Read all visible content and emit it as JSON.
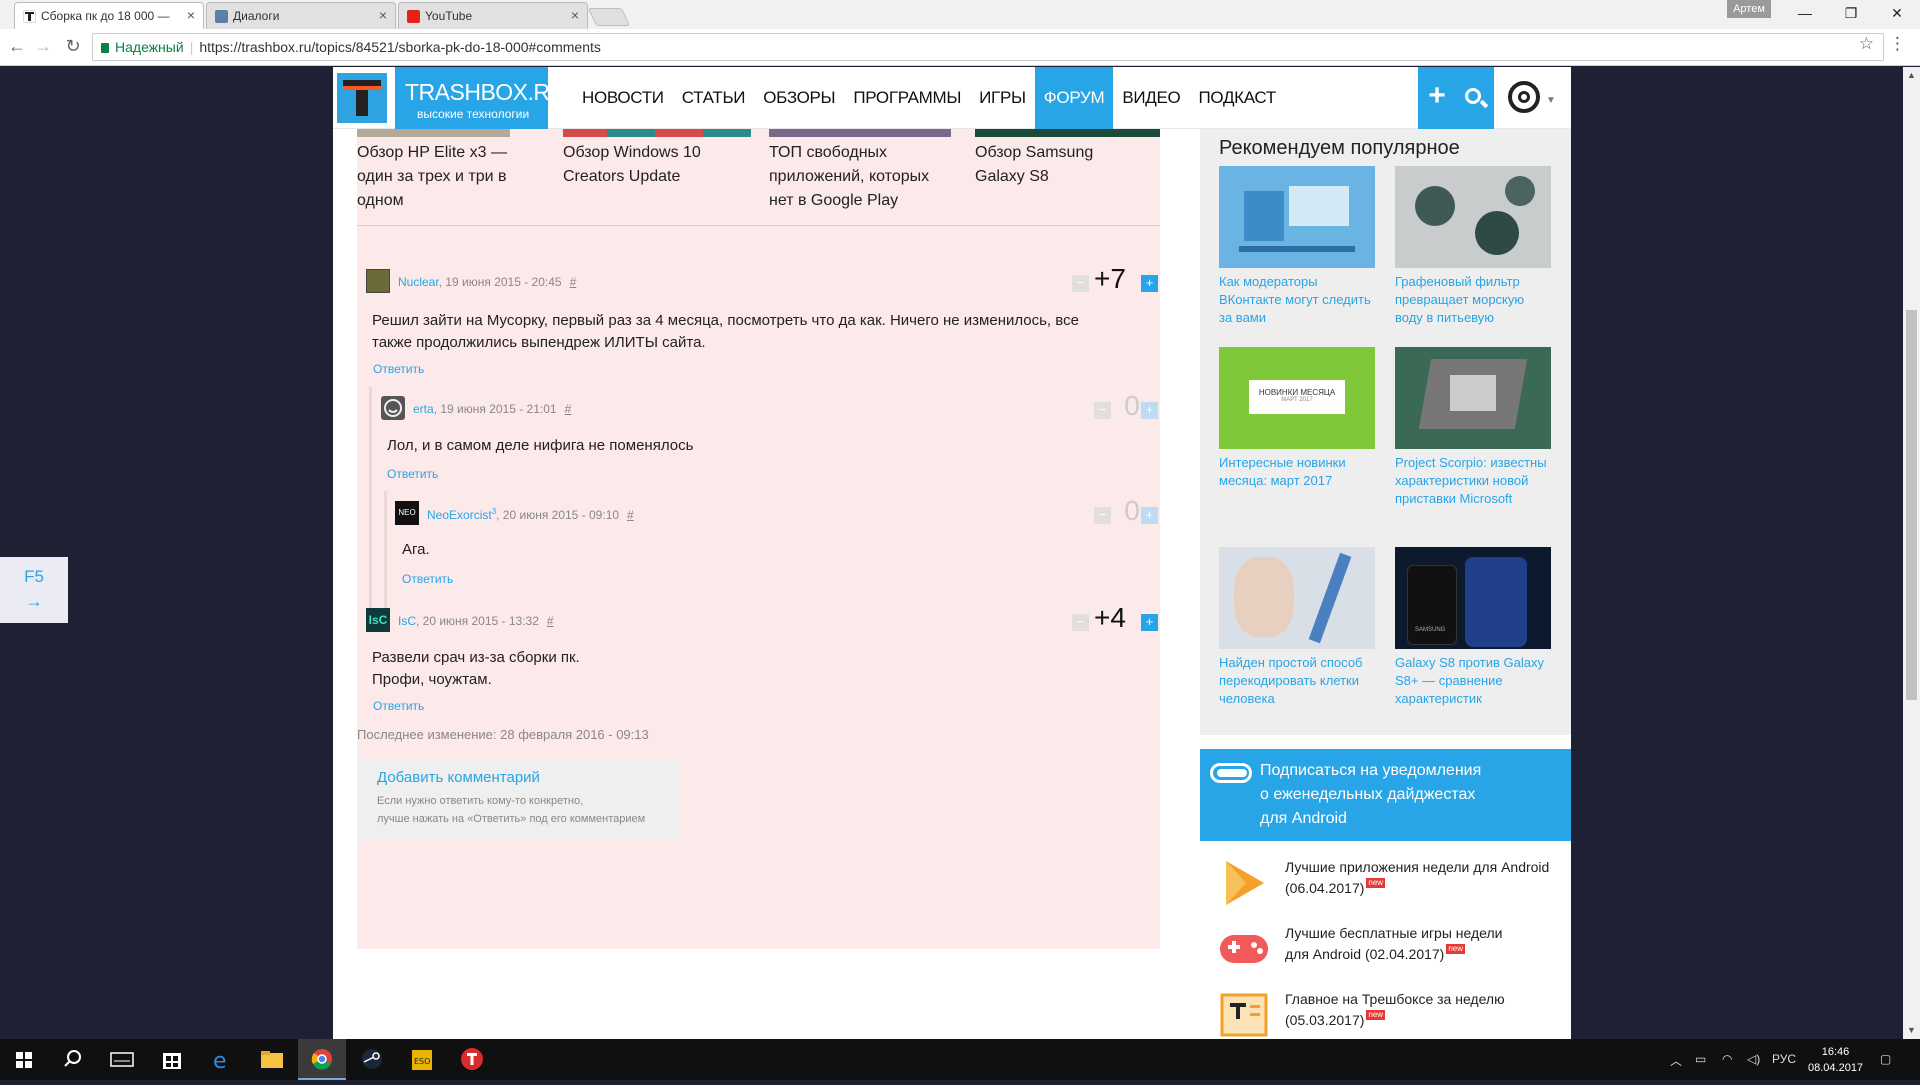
{
  "browser": {
    "tabs": [
      {
        "title": "Сборка пк до 18 000 —",
        "icon": "trashbox-favicon",
        "active": true
      },
      {
        "title": "Диалоги",
        "icon": "vk-favicon",
        "active": false
      },
      {
        "title": "YouTube",
        "icon": "youtube-favicon",
        "active": false
      }
    ],
    "user_badge": "Артем",
    "secure_label": "Надежный",
    "url": "https://trashbox.ru/topics/84521/sborka-pk-do-18-000#comments"
  },
  "site": {
    "brand_name": "TRASHBOX.RU",
    "brand_slogan": "высокие технологии",
    "nav": [
      "НОВОСТИ",
      "СТАТЬИ",
      "ОБЗОРЫ",
      "ПРОГРАММЫ",
      "ИГРЫ",
      "ФОРУМ",
      "ВИДЕО",
      "ПОДКАСТ"
    ],
    "active_nav": "ФОРУМ"
  },
  "related": [
    {
      "title": "Обзор HP Elite x3 — один за трех и три в одном"
    },
    {
      "title": "Обзор Windows 10 Creators Update"
    },
    {
      "title": "ТОП свободных приложений, которых нет в Google Play"
    },
    {
      "title": "Обзор Samsung Galaxy S8"
    }
  ],
  "comments": [
    {
      "author": "Nuclear",
      "date": ", 19 июня 2015 - 20:45",
      "hash": "#",
      "score": "+7",
      "text_lines": [
        "Решил зайти на Мусорку, первый раз за 4 месяца, посмотреть что да как. Ничего не изменилось, все",
        "также продолжились выпендреж ИЛИТЫ сайта."
      ],
      "reply": "Ответить"
    },
    {
      "author": "erta",
      "date": ", 19 июня 2015 - 21:01",
      "hash": "#",
      "score": "0",
      "text_lines": [
        "Лол, и в самом деле нифига не поменялось"
      ],
      "reply": "Ответить"
    },
    {
      "author": "NeoExorcist",
      "author_sup": "3",
      "date": ", 20 июня 2015 - 09:10",
      "hash": "#",
      "score": "0",
      "text_lines": [
        "Ага."
      ],
      "reply": "Ответить"
    },
    {
      "author": "IsC",
      "date": ", 20 июня 2015 - 13:32",
      "hash": "#",
      "score": "+4",
      "text_lines": [
        "Развели срач из-за сборки пк.",
        "Профи, чоужтам."
      ],
      "reply": "Ответить"
    }
  ],
  "vote": {
    "minus": "−",
    "plus": "+"
  },
  "last_modified": "Последнее изменение: 28 февраля 2016 - 09:13",
  "add_comment": {
    "title": "Добавить комментарий",
    "hint1": "Если нужно ответить кому-то конкретно,",
    "hint2": "лучше нажать на «Ответить» под его комментарием"
  },
  "sidebar": {
    "title": "Рекомендуем популярное",
    "items": [
      {
        "caption": "Как модераторы ВКонтакте могут следить за вами"
      },
      {
        "caption": "Графеновый фильтр превращает морскую воду в питьевую"
      },
      {
        "caption": "Интересные новинки месяца: март 2017",
        "img_text1": "НОВИНКИ МЕСЯЦА",
        "img_text2": "МАРТ 2017"
      },
      {
        "caption": "Project Scorpio: известны характеристики новой приставки Microsoft"
      },
      {
        "caption": "Найден простой способ перекодировать клетки человека"
      },
      {
        "caption": "Galaxy S8 против Galaxy S8+ — сравнение характеристик",
        "img_text1": "SAMSUNG"
      }
    ]
  },
  "subscribe": {
    "text": [
      "Подписаться на уведомления",
      "о еженедельных дайджестах",
      "для Android"
    ]
  },
  "digests": [
    {
      "line1": "Лучшие приложения недели для Android",
      "line2": "(06.04.2017)",
      "badge": "new",
      "icon": "play-icon"
    },
    {
      "line1": "Лучшие бесплатные игры недели",
      "line2": "для Android (02.04.2017)",
      "badge": "new",
      "icon": "gamepad-icon"
    },
    {
      "line1": "Главное на Трешбоксе за неделю",
      "line2": "(05.03.2017)",
      "badge": "new",
      "icon": "newspaper-icon"
    }
  ],
  "f5_widget": {
    "key": "F5",
    "arrow": "→"
  },
  "taskbar": {
    "lang": "РУС",
    "time": "16:46",
    "date": "08.04.2017"
  },
  "colors": {
    "accent": "#27a5e6",
    "pink_bg": "#fce9e9",
    "logo_orange": "#ff5722"
  }
}
